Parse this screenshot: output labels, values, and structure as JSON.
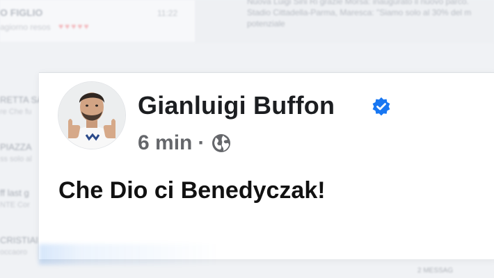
{
  "background": {
    "top_chat": {
      "name": "O FIGLIO",
      "time": "11:22",
      "preview": "agiorno resos"
    },
    "news": {
      "text": "Nuova Luigi Sini Ri grazie Morsa: inaugurato il nuovo parco. Stadio Cittadella-Parma, Maresca: \"Siamo solo al 30% del m potenziale"
    },
    "sidebar_items": [
      {
        "title": "RETTA SA",
        "subtitle": "re Che fu"
      },
      {
        "title": "PIAZZA",
        "subtitle": "ss solo al"
      },
      {
        "title": "ff last g",
        "subtitle": "NTE Cor"
      },
      {
        "title": "CRISTIAI",
        "subtitle": "occaoro"
      }
    ],
    "footer_text": "2 MESSAG"
  },
  "post": {
    "author_name": "Gianluigi Buffon",
    "time": "6 min",
    "separator": "·",
    "text": "Che Dio ci Benedyczak!"
  },
  "icons": {
    "verified": "verified-badge-icon",
    "audience": "globe-icon"
  },
  "colors": {
    "verified_blue": "#1877f2",
    "meta_gray": "#65676b",
    "text_dark": "#1c1e21"
  }
}
